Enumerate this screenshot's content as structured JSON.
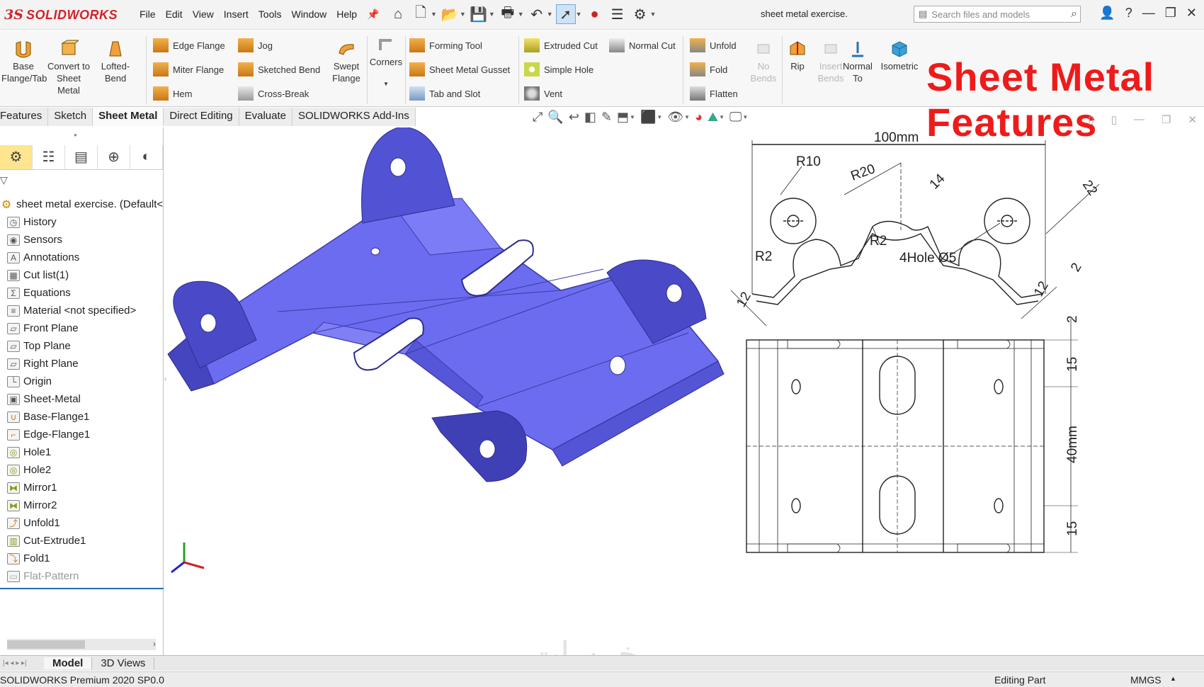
{
  "app": {
    "brand_prefix": "3S",
    "brand": "SOLIDWORKS",
    "document_title": "sheet metal exercise."
  },
  "menu": [
    "File",
    "Edit",
    "View",
    "Insert",
    "Tools",
    "Window",
    "Help"
  ],
  "search": {
    "placeholder": "Search files and models"
  },
  "ribbon": {
    "base_flange": "Base Flange/Tab",
    "convert": "Convert to Sheet Metal",
    "lofted_bend": "Lofted-Bend",
    "edge_flange": "Edge Flange",
    "miter_flange": "Miter Flange",
    "hem": "Hem",
    "jog": "Jog",
    "sketched_bend": "Sketched Bend",
    "cross_break": "Cross-Break",
    "swept_flange": "Swept Flange",
    "corners": "Corners",
    "forming_tool": "Forming Tool",
    "gusset": "Sheet Metal Gusset",
    "tab_slot": "Tab and Slot",
    "extruded_cut": "Extruded Cut",
    "simple_hole": "Simple Hole",
    "vent": "Vent",
    "normal_cut": "Normal Cut",
    "unfold": "Unfold",
    "fold": "Fold",
    "flatten": "Flatten",
    "no_bends": "No Bends",
    "rip": "Rip",
    "insert_bends": "Insert Bends",
    "normal_to": "Normal To",
    "isometric": "Isometric"
  },
  "banner": {
    "line1": "Sheet Metal",
    "line2": "Features"
  },
  "tabs": [
    "Features",
    "Sketch",
    "Sheet Metal",
    "Direct Editing",
    "Evaluate",
    "SOLIDWORKS Add-Ins"
  ],
  "tree": {
    "root": "sheet metal exercise.  (Default<",
    "items": [
      "History",
      "Sensors",
      "Annotations",
      "Cut list(1)",
      "Equations",
      "Material <not specified>",
      "Front Plane",
      "Top Plane",
      "Right Plane",
      "Origin",
      "Sheet-Metal",
      "Base-Flange1",
      "Edge-Flange1",
      "Hole1",
      "Hole2",
      "Mirror1",
      "Mirror2",
      "Unfold1",
      "Cut-Extrude1",
      "Fold1",
      "Flat-Pattern"
    ]
  },
  "drawing": {
    "dim_width": "100mm",
    "r10": "R10",
    "r20": "R20",
    "d14": "14",
    "d22": "22",
    "r2a": "R2",
    "r2b": "R2",
    "hole": "4Hole  Ø5",
    "d12a": "12",
    "d12b": "12",
    "d2a": "2",
    "d2b": "2",
    "d15a": "15",
    "d40": "40mm",
    "d15b": "15"
  },
  "bottom_tabs": [
    "Model",
    "3D Views"
  ],
  "status": {
    "version": "SOLIDWORKS Premium 2020 SP0.0",
    "mode": "Editing Part",
    "units": "MMGS"
  },
  "watermark": "خمسات",
  "colors": {
    "part": "#6c6cf0",
    "part_dark": "#4848c8",
    "banner": "#ee1b1b",
    "accent": "#d3232b"
  }
}
